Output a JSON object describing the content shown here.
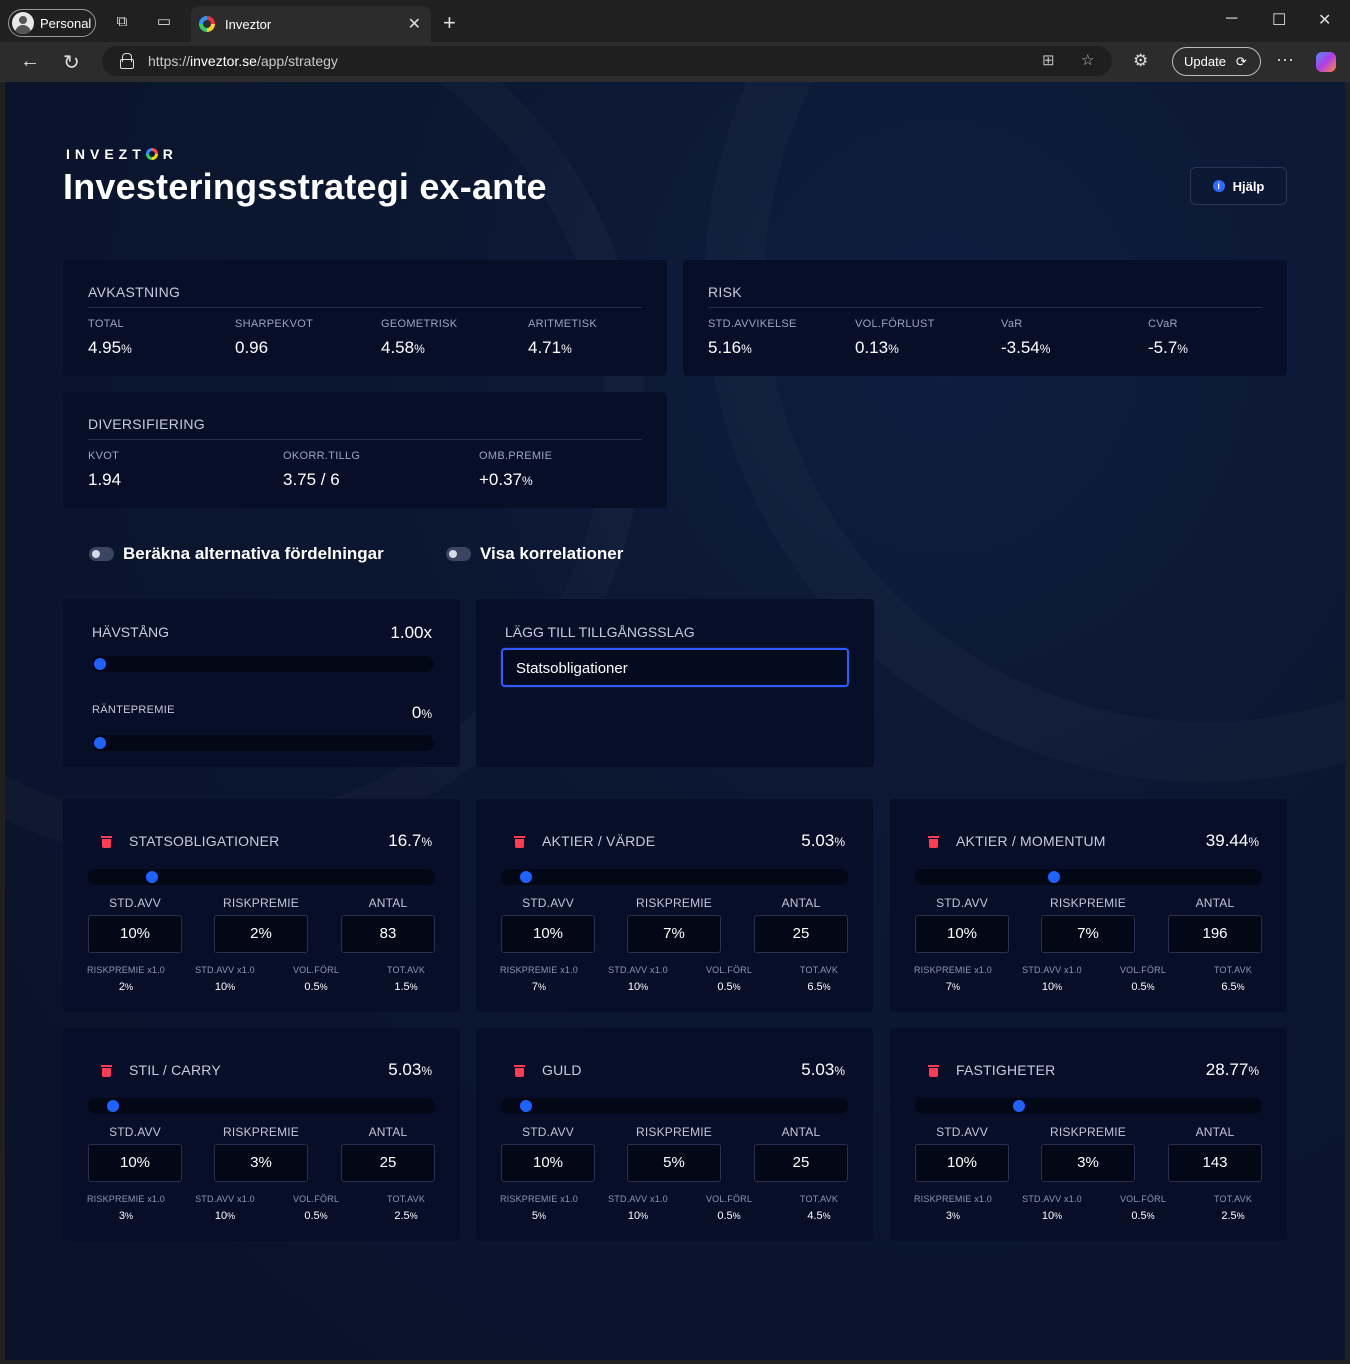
{
  "browser": {
    "profile_label": "Personal",
    "tab_title": "Inveztor",
    "url_prefix": "https://",
    "url_domain": "inveztor.se",
    "url_path": "/app/strategy",
    "update_label": "Update"
  },
  "header": {
    "logo_text_a": "INVEZT",
    "logo_text_b": "R",
    "title": "Investeringsstrategi ex-ante",
    "help_label": "Hjälp"
  },
  "avkastning": {
    "title": "AVKASTNING",
    "metrics": [
      {
        "label": "TOTAL",
        "value": "4.95",
        "unit": "%"
      },
      {
        "label": "SHARPEKVOT",
        "value": "0.96",
        "unit": ""
      },
      {
        "label": "GEOMETRISK",
        "value": "4.58",
        "unit": "%"
      },
      {
        "label": "ARITMETISK",
        "value": "4.71",
        "unit": "%"
      }
    ]
  },
  "risk": {
    "title": "RISK",
    "metrics": [
      {
        "label": "STD.AVVIKELSE",
        "value": "5.16",
        "unit": "%"
      },
      {
        "label": "VOL.FÖRLUST",
        "value": "0.13",
        "unit": "%"
      },
      {
        "label": "VaR",
        "value": "-3.54",
        "unit": "%"
      },
      {
        "label": "CVaR",
        "value": "-5.7",
        "unit": "%"
      }
    ]
  },
  "diversifiering": {
    "title": "DIVERSIFIERING",
    "metrics": [
      {
        "label": "KVOT",
        "value": "1.94",
        "unit": ""
      },
      {
        "label": "OKORR.TILLG",
        "value": "3.75 / 6",
        "unit": ""
      },
      {
        "label": "OMB.PREMIE",
        "value": "+0.37",
        "unit": "%"
      }
    ]
  },
  "toggles": {
    "alt_label": "Beräkna alternativa fördelningar",
    "corr_label": "Visa korrelationer"
  },
  "leverage": {
    "label": "HÄVSTÅNG",
    "value": "1.00x",
    "level": 0,
    "rate_label": "RÄNTEPREMIE",
    "rate_value": "0",
    "rate_unit": "%",
    "rate_level": 0
  },
  "add_asset": {
    "label": "LÄGG TILL TILLGÅNGSSLAG",
    "selected": "Statsobligationer"
  },
  "assets": [
    {
      "name": "STATSOBLIGATIONER",
      "weight": "16.7",
      "weight_level": 0.167,
      "std": "10%",
      "premium": "2%",
      "count": "83",
      "rp": "2",
      "sd": "10",
      "vf": "0.5",
      "tot": "1.5"
    },
    {
      "name": "AKTIER / VÄRDE",
      "weight": "5.03",
      "weight_level": 0.0503,
      "std": "10%",
      "premium": "7%",
      "count": "25",
      "rp": "7",
      "sd": "10",
      "vf": "0.5",
      "tot": "6.5"
    },
    {
      "name": "AKTIER / MOMENTUM",
      "weight": "39.44",
      "weight_level": 0.3944,
      "std": "10%",
      "premium": "7%",
      "count": "196",
      "rp": "7",
      "sd": "10",
      "vf": "0.5",
      "tot": "6.5"
    },
    {
      "name": "STIL / CARRY",
      "weight": "5.03",
      "weight_level": 0.0503,
      "std": "10%",
      "premium": "3%",
      "count": "25",
      "rp": "3",
      "sd": "10",
      "vf": "0.5",
      "tot": "2.5"
    },
    {
      "name": "GULD",
      "weight": "5.03",
      "weight_level": 0.0503,
      "std": "10%",
      "premium": "5%",
      "count": "25",
      "rp": "5",
      "sd": "10",
      "vf": "0.5",
      "tot": "4.5"
    },
    {
      "name": "FASTIGHETER",
      "weight": "28.77",
      "weight_level": 0.2877,
      "std": "10%",
      "premium": "3%",
      "count": "143",
      "rp": "3",
      "sd": "10",
      "vf": "0.5",
      "tot": "2.5"
    }
  ],
  "asset_labels": {
    "std": "STD.AVV",
    "premium": "RISKPREMIE",
    "count": "ANTAL",
    "rp": "RISKPREMIE x1.0",
    "sd": "STD.AVV x1.0",
    "vf": "VOL.FÖRL",
    "tot": "TOT.AVK",
    "unit": "%"
  },
  "colors": {
    "accent": "#1e62ff",
    "danger": "#ff3b55",
    "card": "#070f28",
    "bg": "#0b1630"
  }
}
